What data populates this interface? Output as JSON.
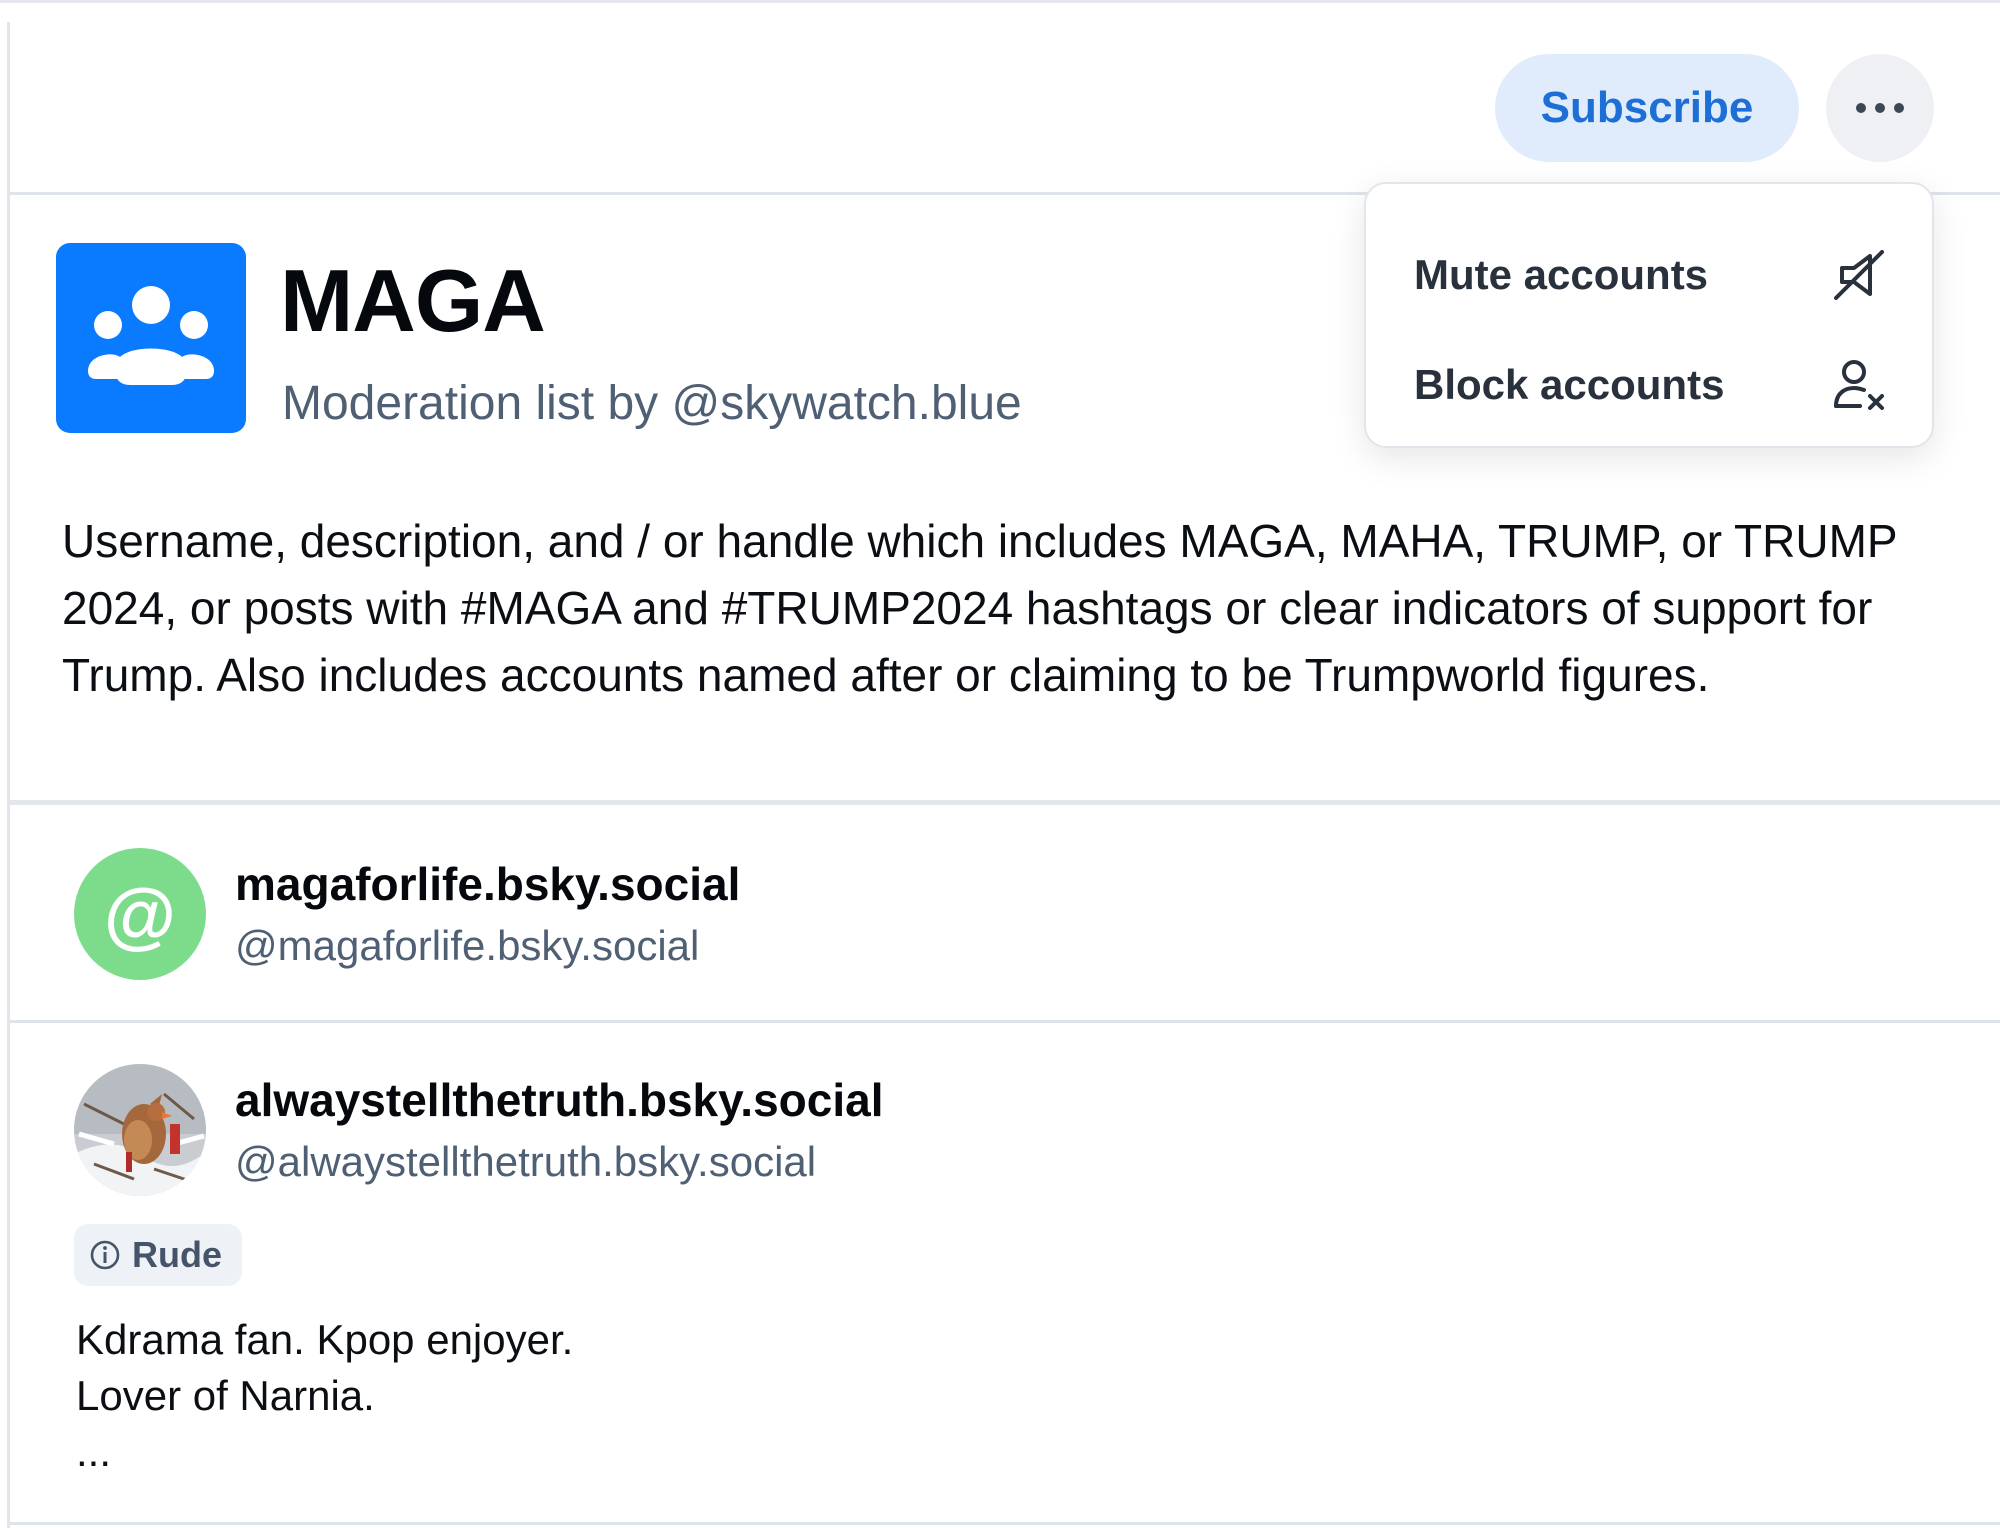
{
  "header": {
    "subscribe_label": "Subscribe",
    "more_icon": "ellipsis-icon"
  },
  "menu": {
    "items": [
      {
        "label": "Mute accounts",
        "icon": "mute-icon"
      },
      {
        "label": "Block accounts",
        "icon": "block-user-icon"
      }
    ]
  },
  "list": {
    "icon": "users-group-icon",
    "avatar_color": "#0a7aff",
    "title": "MAGA",
    "subtitle": "Moderation list by @skywatch.blue",
    "description": "Username, description, and / or handle which includes MAGA, MAHA, TRUMP, or TRUMP 2024, or posts with #MAGA and #TRUMP2024 hashtags or clear indicators of support for Trump. Also includes accounts named after or claiming to be Trumpworld figures."
  },
  "accounts": [
    {
      "display_name": "magaforlife.bsky.social",
      "handle": "@magaforlife.bsky.social",
      "avatar_glyph": "@",
      "avatar_color": "#7ddc8c"
    },
    {
      "display_name": "alwaystellthetruth.bsky.social",
      "handle": "@alwaystellthetruth.bsky.social",
      "avatar_description": "cardinal-bird-photo",
      "label": "Rude",
      "label_icon": "info-icon",
      "bio_lines": [
        "Kdrama fan.  Kpop enjoyer.",
        "Lover of Narnia.",
        "..."
      ]
    }
  ],
  "colors": {
    "accent": "#1d6fd6",
    "subscribe_bg": "#e0ecfb",
    "muted_text": "#4f5f74"
  }
}
